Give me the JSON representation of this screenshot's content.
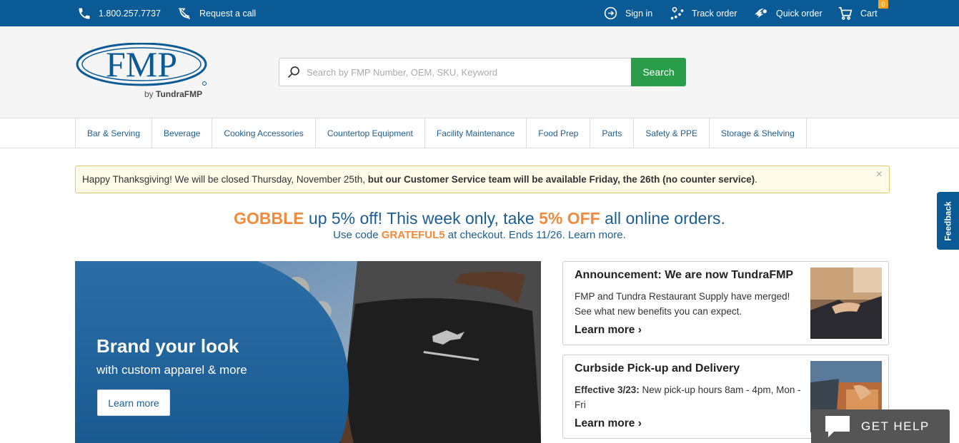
{
  "topbar": {
    "phone": "1.800.257.7737",
    "request_call": "Request a call",
    "sign_in": "Sign in",
    "track_order": "Track order",
    "quick_order": "Quick order",
    "cart": "Cart",
    "cart_count": "0"
  },
  "header": {
    "logo_text": "FMP",
    "logo_sub_by": "by ",
    "logo_sub_brand": "TundraFMP",
    "search_placeholder": "Search by FMP Number, OEM, SKU, Keyword",
    "search_button": "Search"
  },
  "nav": {
    "items": [
      "Bar & Serving",
      "Beverage",
      "Cooking Accessories",
      "Countertop Equipment",
      "Facility Maintenance",
      "Food Prep",
      "Parts",
      "Safety & PPE",
      "Storage & Shelving"
    ]
  },
  "alert": {
    "text_normal": "Happy Thanksgiving! We will be closed Thursday, November 25th, ",
    "text_bold": "but our Customer Service team will be available Friday, the 26th (no counter service)",
    "text_end": ".",
    "close": "×"
  },
  "promo": {
    "gobble": "GOBBLE",
    "line1_a": " up 5% off! This week only, take ",
    "five_off": "5% OFF",
    "line1_b": " all online orders.",
    "line2_a": "Use code ",
    "code": "GRATEFUL5",
    "line2_b": " at checkout. Ends 11/26. Learn more."
  },
  "hero": {
    "title": "Brand your look",
    "subtitle": "with custom apparel & more",
    "button": "Learn more"
  },
  "cards": [
    {
      "title": "Announcement: We are now TundraFMP",
      "body": "FMP and Tundra Restaurant Supply have merged! See what new benefits you can expect.",
      "link": "Learn more ›"
    },
    {
      "title": "Curbside Pick-up and Delivery",
      "body_bold": "Effective 3/23:",
      "body": " New pick-up hours 8am - 4pm, Mon - Fri",
      "link": "Learn more ›"
    }
  ],
  "feedback": "Feedback",
  "get_help": "GET HELP",
  "colors": {
    "brand_blue": "#0a5a96",
    "search_green": "#2a9d4a",
    "promo_orange": "#f08a3c",
    "link_blue": "#1d5e92"
  },
  "icons": [
    "phone-icon",
    "request-call-icon",
    "sign-in-icon",
    "track-order-icon",
    "quick-order-icon",
    "cart-icon",
    "search-icon",
    "close-icon",
    "chat-icon"
  ]
}
